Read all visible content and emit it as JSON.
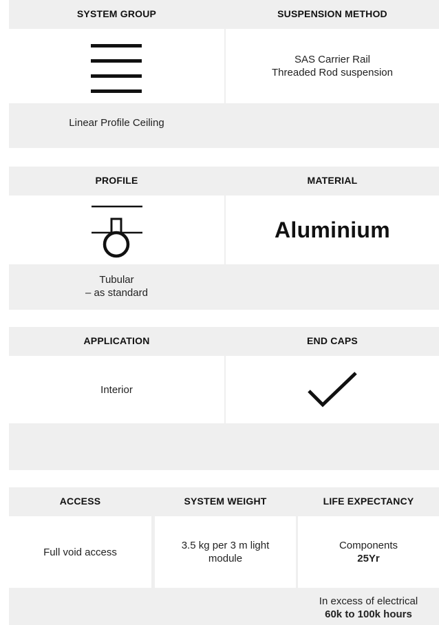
{
  "panel1": {
    "left_header": "SYSTEM GROUP",
    "right_header": "SUSPENSION METHOD",
    "left_icon": "stacked-lines-icon",
    "right_lines": [
      "SAS Carrier Rail",
      "Threaded Rod suspension"
    ],
    "left_footer": "Linear Profile Ceiling"
  },
  "panel2": {
    "left_header": "PROFILE",
    "right_header": "MATERIAL",
    "left_icon": "tubular-profile-icon",
    "right_value": "Aluminium",
    "left_footer_lines": [
      "Tubular",
      "– as standard"
    ]
  },
  "panel3": {
    "left_header": "APPLICATION",
    "right_header": "END CAPS",
    "left_value": "Interior",
    "right_icon": "checkmark-icon"
  },
  "panel4": {
    "col1_header": "ACCESS",
    "col2_header": "SYSTEM WEIGHT",
    "col3_header": "LIFE EXPECTANCY",
    "col1_value": "Full void access",
    "col2_lines": [
      "3.5 kg per 3 m light",
      "module"
    ],
    "col3_label": "Components",
    "col3_value": "25Yr",
    "col3_footer_label": "In excess of electrical",
    "col3_footer_value": "60k to 100k hours"
  }
}
